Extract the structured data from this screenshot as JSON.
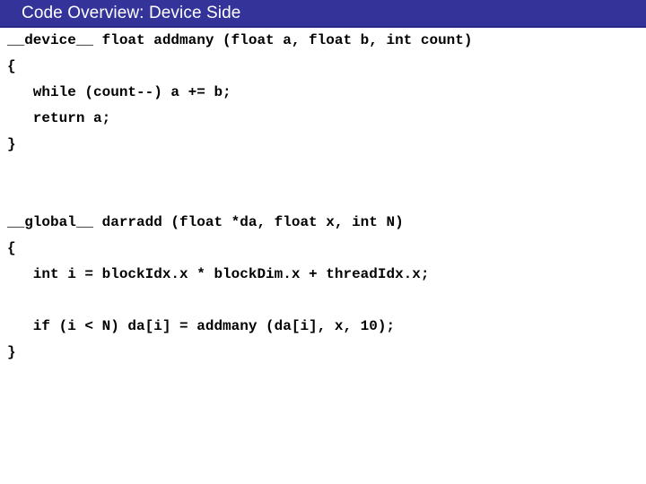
{
  "slide": {
    "title": "Code Overview: Device Side",
    "title_bar_color": "#333399",
    "title_text_color": "#ffffff",
    "background_color": "#ffffff",
    "code_text_color": "#000000"
  },
  "code": {
    "lines": [
      {
        "text": "__device__ float addmany (float a, float b, int count)"
      },
      {
        "text": "{"
      },
      {
        "text": "   while (count--) a += b;"
      },
      {
        "text": "   return a;"
      },
      {
        "text": "}"
      },
      {
        "text": ""
      },
      {
        "text": ""
      },
      {
        "text": "__global__ darradd (float *da, float x, int N)"
      },
      {
        "text": "{"
      },
      {
        "text": "   int i = blockIdx.x * blockDim.x + threadIdx.x;"
      },
      {
        "text": ""
      },
      {
        "text": "   if (i < N) da[i] = addmany (da[i], x, 10);"
      },
      {
        "text": "}"
      }
    ]
  }
}
